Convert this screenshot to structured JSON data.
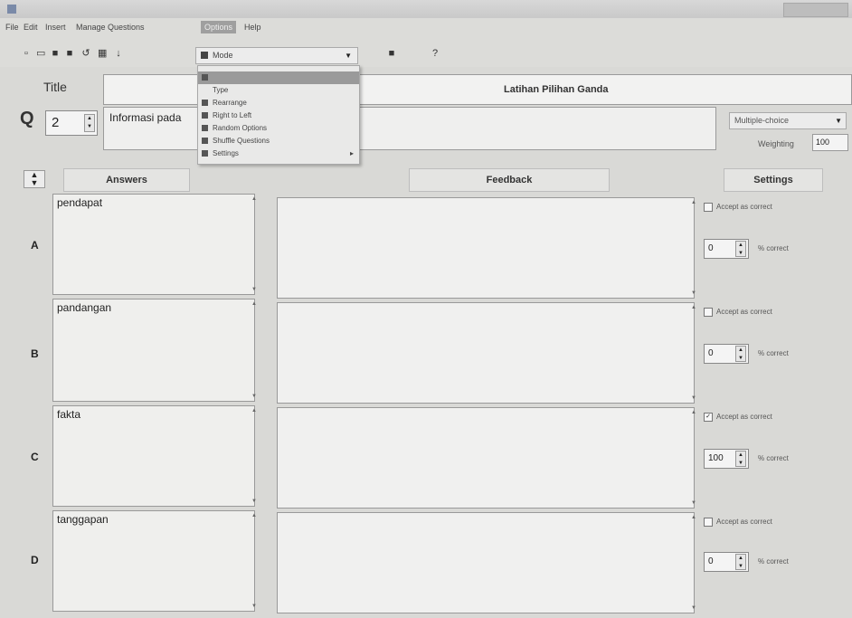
{
  "window": {
    "title": ""
  },
  "menubar": {
    "items": [
      "File",
      "Edit",
      "Insert",
      "Manage Questions",
      "Options",
      "Help"
    ]
  },
  "toolbar": {
    "icons": [
      "new-file-icon",
      "open-folder-icon",
      "save-icon",
      "save-as-icon",
      "undo-icon",
      "grid-icon",
      "arrow-icon",
      "camera-icon",
      "help-icon"
    ],
    "mode": {
      "selected": "Mode"
    }
  },
  "dropdown": {
    "items": [
      {
        "label": "",
        "highlighted": true
      },
      {
        "label": "Type"
      },
      {
        "label": "Rearrange",
        "submenu": true
      },
      {
        "label": "Right to Left"
      },
      {
        "label": "Random Options"
      },
      {
        "label": "Shuffle Questions"
      },
      {
        "label": "Settings",
        "submenu": true
      }
    ]
  },
  "exercise": {
    "title_label": "Title",
    "title_value": "Latihan Pilihan Ganda",
    "q_label": "Q",
    "q_number": "2",
    "q_text": "Informasi pada",
    "q_type": "Multiple-choice",
    "weighting_label": "Weighting",
    "weighting_value": "100"
  },
  "columns": {
    "answers": "Answers",
    "feedback": "Feedback",
    "settings": "Settings"
  },
  "answers": [
    {
      "letter": "A",
      "text": "pendapat",
      "accept": false,
      "accept_label": "Accept as correct",
      "percent": "0",
      "percent_label": "% correct"
    },
    {
      "letter": "B",
      "text": "pandangan",
      "accept": false,
      "accept_label": "Accept as correct",
      "percent": "0",
      "percent_label": "% correct"
    },
    {
      "letter": "C",
      "text": "fakta",
      "accept": true,
      "accept_label": "Accept as correct",
      "percent": "100",
      "percent_label": "% correct"
    },
    {
      "letter": "D",
      "text": "tanggapan",
      "accept": false,
      "accept_label": "Accept as correct",
      "percent": "0",
      "percent_label": "% correct"
    }
  ],
  "colors": {
    "background": "#d9d9d6",
    "highlight": "#9a9a9a"
  }
}
